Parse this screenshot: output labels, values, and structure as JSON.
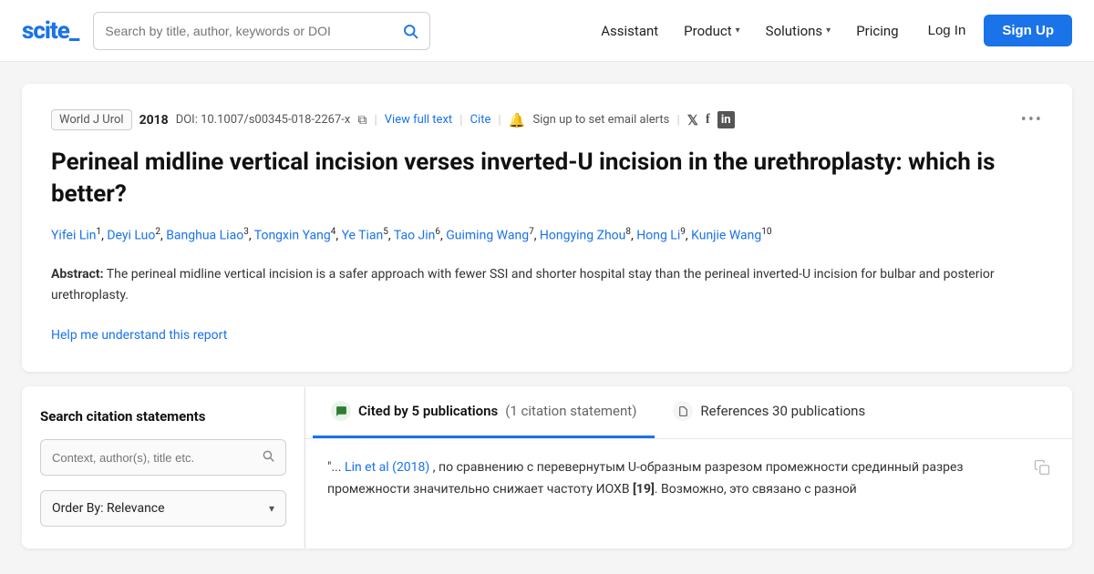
{
  "logo": {
    "text": "scite_"
  },
  "search": {
    "placeholder": "Search by title, author, keywords or DOI"
  },
  "nav": {
    "assistant": "Assistant",
    "product": "Product",
    "solutions": "Solutions",
    "pricing": "Pricing",
    "login": "Log In",
    "signup": "Sign Up"
  },
  "article": {
    "journal": "World J Urol",
    "year": "2018",
    "doi": "DOI: 10.1007/s00345-018-2267-x",
    "view_full_text": "View full text",
    "cite": "Cite",
    "alert_text": "Sign up to set email alerts",
    "title": "Perineal midline vertical incision verses inverted-U incision in the urethroplasty: which is better?",
    "authors": [
      {
        "name": "Yifei Lin",
        "sup": "1"
      },
      {
        "name": "Deyi Luo",
        "sup": "2"
      },
      {
        "name": "Banghua Liao",
        "sup": "3"
      },
      {
        "name": "Tongxin Yang",
        "sup": "4"
      },
      {
        "name": "Ye Tian",
        "sup": "5"
      },
      {
        "name": "Tao Jin",
        "sup": "6"
      },
      {
        "name": "Guiming Wang",
        "sup": "7"
      },
      {
        "name": "Hongying Zhou",
        "sup": "8"
      },
      {
        "name": "Hong Li",
        "sup": "9"
      },
      {
        "name": "Kunjie Wang",
        "sup": "10"
      }
    ],
    "abstract_label": "Abstract:",
    "abstract": "The perineal midline vertical incision is a safer approach with fewer SSI and shorter hospital stay than the perineal inverted-U incision for bulbar and posterior urethroplasty.",
    "help_link": "Help me understand this report"
  },
  "sidebar": {
    "title": "Search citation statements",
    "context_placeholder": "Context, author(s), title etc.",
    "order_by_label": "Order By: Relevance"
  },
  "tabs": {
    "cited_label": "Cited by 5 publications",
    "cited_sub": "(1 citation statement)",
    "refs_label": "References 30 publications"
  },
  "citation_snippet": {
    "text_before": "\"... ",
    "author_link": "Lin et al (2018)",
    "text_middle": " , по сравнению с перевернутым U-образным разрезом промежности срединный разрез промежности значительно снижает частоту ИОХВ ",
    "bracket_num": "[19]",
    "text_after": ". Возможно, это связано с разной"
  },
  "icons": {
    "search": "🔍",
    "copy": "⧉",
    "bell": "🔔",
    "twitter": "𝕏",
    "facebook": "f",
    "linkedin": "in",
    "more": "•••",
    "chat_bubble": "💬",
    "document": "📄",
    "chevron_down": "▾",
    "magnifier": "⌕",
    "copy_small": "⧉"
  },
  "colors": {
    "primary": "#1a73e8",
    "cited_bg": "#e8f5e9",
    "cited_color": "#2e7d32"
  }
}
